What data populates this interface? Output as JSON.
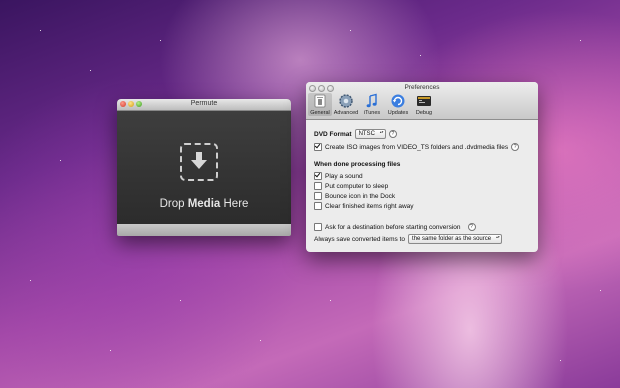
{
  "permute": {
    "title": "Permute",
    "drop_prefix": "Drop ",
    "drop_bold": "Media",
    "drop_suffix": " Here"
  },
  "preferences": {
    "title": "Preferences",
    "toolbar": [
      {
        "label": "General",
        "icon": "general-icon"
      },
      {
        "label": "Advanced",
        "icon": "gear-icon"
      },
      {
        "label": "iTunes",
        "icon": "itunes-icon"
      },
      {
        "label": "Updates",
        "icon": "updates-icon"
      },
      {
        "label": "Debug",
        "icon": "debug-icon"
      }
    ],
    "dvd_format_label": "DVD Format",
    "dvd_format_value": "NTSC",
    "create_iso_label": "Create ISO images from VIDEO_TS folders and .dvdmedia files",
    "create_iso_checked": true,
    "done_heading": "When done processing files",
    "play_sound": "Play a sound",
    "play_sound_checked": true,
    "put_sleep": "Put computer to sleep",
    "bounce_icon": "Bounce icon in the Dock",
    "clear_finished": "Clear finished items right away",
    "ask_destination": "Ask for a destination before starting conversion",
    "always_save_label": "Always save converted items to",
    "always_save_value": "the same folder as the source",
    "help_glyph": "?"
  },
  "colors": {
    "accent_blue": "#2a6fd6"
  }
}
